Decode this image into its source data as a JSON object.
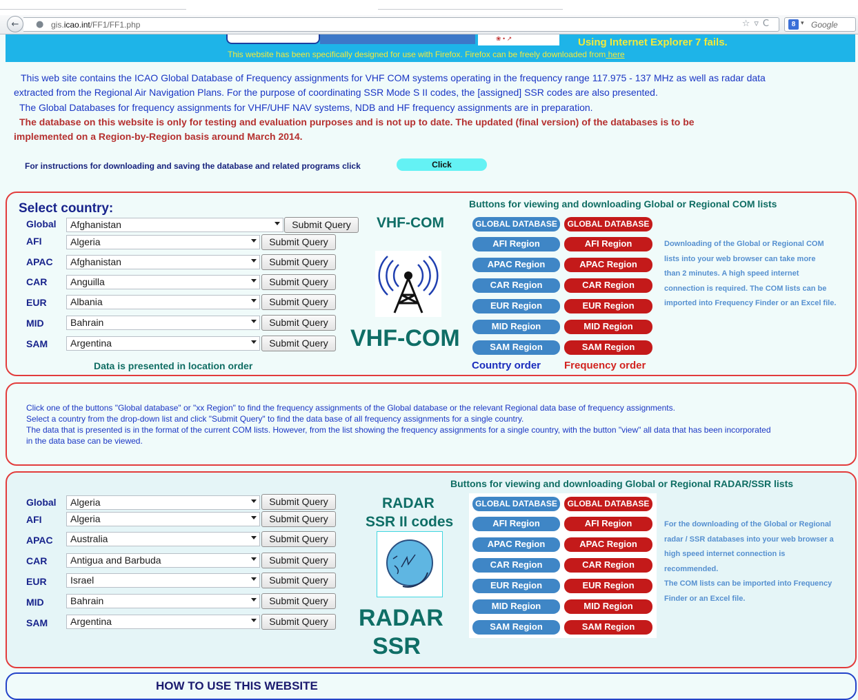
{
  "browser": {
    "url_prefix": "gis.",
    "url_domain": "icao.int",
    "url_path": "/FF1/FF1.php",
    "search_placeholder": "Google",
    "search_badge": "8"
  },
  "banner": {
    "ie_warning": "Using Internet Explorer 7 fails.",
    "firefox_note": "This website has been specifically designed for use with Firefox. Firefox can be freely downloaded from",
    "firefox_link": " here"
  },
  "intro": {
    "line1": "This web site contains the ICAO Global Database of Frequency assignments for VHF COM systems operating in the frequency range 117.975 - 137 MHz as well as radar data",
    "line2": "extracted from the Regional Air Navigation Plans. For the purpose of coordinating SSR Mode S II codes, the [assigned] SSR codes are also presented.",
    "line3": "The Global Databases for frequency assignments for VHF/UHF NAV systems, NDB and HF frequency assignments are in preparation.",
    "warning1": "The database on this website is only for testing and evaluation purposes and is not up to date. The updated (final version) of the databases is to be",
    "warning2": "implemented on a Region-by-Region basis around March 2014.",
    "instructions": "For instructions for downloading and saving the database and related programs click",
    "click_label": "Click"
  },
  "com_section": {
    "select_title": "Select country:",
    "rows": [
      {
        "region": "Global",
        "country": "Afghanistan",
        "submit": "Submit Query"
      },
      {
        "region": "AFI",
        "country": "Algeria",
        "submit": "Submit Query"
      },
      {
        "region": "APAC",
        "country": "Afghanistan",
        "submit": "Submit Query"
      },
      {
        "region": "CAR",
        "country": "Anguilla",
        "submit": "Submit Query"
      },
      {
        "region": "EUR",
        "country": "Albania",
        "submit": "Submit Query"
      },
      {
        "region": "MID",
        "country": "Bahrain",
        "submit": "Submit Query"
      },
      {
        "region": "SAM",
        "country": "Argentina",
        "submit": "Submit Query"
      }
    ],
    "location_note": "Data is presented in location order",
    "title_small": "VHF-COM",
    "title_large": "VHF-COM",
    "buttons_heading": "Buttons for viewing and downloading Global or Regional COM lists",
    "blue_buttons": [
      "GLOBAL DATABASE",
      "AFI Region",
      "APAC Region",
      "CAR Region",
      "EUR Region",
      "MID Region",
      "SAM Region"
    ],
    "red_buttons": [
      "GLOBAL DATABASE",
      "AFI Region",
      "APAC Region",
      "CAR Region",
      "EUR Region",
      "MID Region",
      "SAM Region"
    ],
    "country_order": "Country order",
    "frequency_order": "Frequency order",
    "side_note": [
      "Downloading of the Global or Regional COM",
      "lists into your web browser can take more",
      "than 2 minutes. A high speed internet",
      "connection is required. The COM lists can be",
      "imported into Frequency Finder or an Excel file."
    ]
  },
  "info": {
    "line1": "Click one of the buttons \"Global database\" or \"xx Region\" to find the frequency assignments of the Global database or the relevant Regional data base of frequency assignments.",
    "line2": "Select a country from the drop-down list and click \"Submit Query\" to find the data base of all frequency assignments for a single country.",
    "line3": "The data that is presented is in the format of the current COM lists. However, from the list showing the frequency assignments for a single country, with the button \"view\" all data that has been incorporated",
    "line4": "in the data base can be viewed."
  },
  "radar_section": {
    "rows": [
      {
        "region": "Global",
        "country": "Algeria",
        "submit": "Submit Query"
      },
      {
        "region": "AFI",
        "country": "Algeria",
        "submit": "Submit Query"
      },
      {
        "region": "APAC",
        "country": "Australia",
        "submit": "Submit Query"
      },
      {
        "region": "CAR",
        "country": "Antigua and Barbuda",
        "submit": "Submit Query"
      },
      {
        "region": "EUR",
        "country": "Israel",
        "submit": "Submit Query"
      },
      {
        "region": "MID",
        "country": "Bahrain",
        "submit": "Submit Query"
      },
      {
        "region": "SAM",
        "country": "Argentina",
        "submit": "Submit Query"
      }
    ],
    "title_line1": "RADAR",
    "title_line2": "SSR II codes",
    "big_line1": "RADAR",
    "big_line2": "SSR",
    "buttons_heading": "Buttons for viewing and downloading Global or Regional RADAR/SSR lists",
    "blue_buttons": [
      "GLOBAL DATABASE",
      "AFI Region",
      "APAC Region",
      "CAR Region",
      "EUR Region",
      "MID Region",
      "SAM Region"
    ],
    "red_buttons": [
      "GLOBAL DATABASE",
      "AFI Region",
      "APAC Region",
      "CAR Region",
      "EUR Region",
      "MID Region",
      "SAM Region"
    ],
    "side_note": [
      "For the downloading of the Global or Regional",
      "radar / SSR databases into your web browser a",
      "high speed internet connection is",
      "recommended.",
      "The COM lists can be imported into Frequency",
      "Finder or an Excel file."
    ]
  },
  "howto": {
    "title": "HOW TO USE THIS WEBSITE"
  },
  "colors": {
    "banner": "#1eb4e8",
    "section_border": "#e23b3b",
    "pill_blue": "#3f86c6",
    "pill_red": "#c41a1a",
    "heading_teal": "#0f6d63",
    "text_blue": "#1a36c4"
  },
  "icons": {
    "vhf": "radio-tower-icon",
    "radar": "radar-icon"
  }
}
